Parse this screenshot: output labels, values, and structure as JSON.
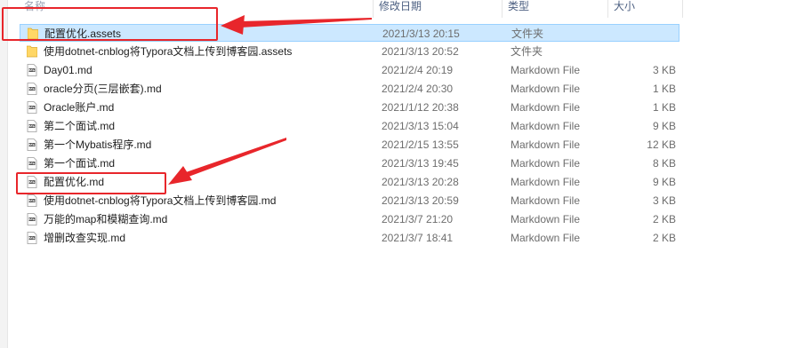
{
  "columns": {
    "name": "名称",
    "date": "修改日期",
    "type": "类型",
    "size": "大小"
  },
  "files": [
    {
      "name": "配置优化.assets",
      "date": "2021/3/13 20:15",
      "type": "文件夹",
      "size": "",
      "icon": "folder-icon",
      "selected": true
    },
    {
      "name": "使用dotnet-cnblog将Typora文档上传到博客园.assets",
      "date": "2021/3/13 20:52",
      "type": "文件夹",
      "size": "",
      "icon": "folder-icon",
      "selected": false
    },
    {
      "name": "Day01.md",
      "date": "2021/2/4 20:19",
      "type": "Markdown File",
      "size": "3 KB",
      "icon": "markdown-file-icon",
      "selected": false
    },
    {
      "name": "oracle分页(三层嵌套).md",
      "date": "2021/2/4 20:30",
      "type": "Markdown File",
      "size": "1 KB",
      "icon": "markdown-file-icon",
      "selected": false
    },
    {
      "name": "Oracle账户.md",
      "date": "2021/1/12 20:38",
      "type": "Markdown File",
      "size": "1 KB",
      "icon": "markdown-file-icon",
      "selected": false
    },
    {
      "name": "第二个面试.md",
      "date": "2021/3/13 15:04",
      "type": "Markdown File",
      "size": "9 KB",
      "icon": "markdown-file-icon",
      "selected": false
    },
    {
      "name": "第一个Mybatis程序.md",
      "date": "2021/2/15 13:55",
      "type": "Markdown File",
      "size": "12 KB",
      "icon": "markdown-file-icon",
      "selected": false
    },
    {
      "name": "第一个面试.md",
      "date": "2021/3/13 19:45",
      "type": "Markdown File",
      "size": "8 KB",
      "icon": "markdown-file-icon",
      "selected": false
    },
    {
      "name": "配置优化.md",
      "date": "2021/3/13 20:28",
      "type": "Markdown File",
      "size": "9 KB",
      "icon": "markdown-file-icon",
      "selected": false
    },
    {
      "name": "使用dotnet-cnblog将Typora文档上传到博客园.md",
      "date": "2021/3/13 20:59",
      "type": "Markdown File",
      "size": "3 KB",
      "icon": "markdown-file-icon",
      "selected": false
    },
    {
      "name": "万能的map和模糊查询.md",
      "date": "2021/3/7 21:20",
      "type": "Markdown File",
      "size": "2 KB",
      "icon": "markdown-file-icon",
      "selected": false
    },
    {
      "name": "增删改查实现.md",
      "date": "2021/3/7 18:41",
      "type": "Markdown File",
      "size": "2 KB",
      "icon": "markdown-file-icon",
      "selected": false
    }
  ],
  "colors": {
    "selection_bg": "#cce8ff",
    "selection_border": "#99d1ff",
    "annotation_red": "#e8262b",
    "folder_yellow": "#ffd766"
  }
}
